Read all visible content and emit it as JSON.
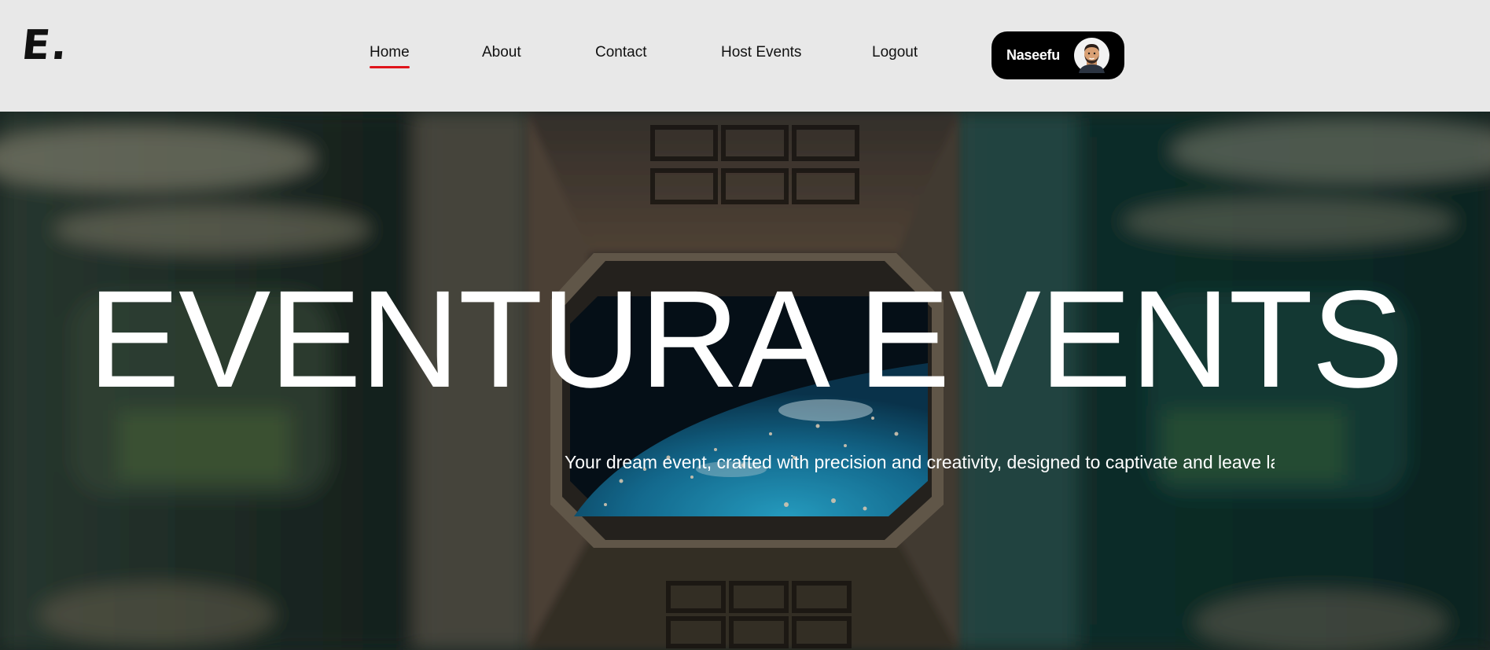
{
  "brand": {
    "logo_text": "E."
  },
  "nav": {
    "items": [
      {
        "label": "Home",
        "active": true
      },
      {
        "label": "About",
        "active": false
      },
      {
        "label": "Contact",
        "active": false
      },
      {
        "label": "Host Events",
        "active": false
      },
      {
        "label": "Logout",
        "active": false
      }
    ]
  },
  "user": {
    "name": "Naseefu",
    "avatar_icon": "user-avatar-icon"
  },
  "hero": {
    "title": "EVENTURA EVENTS",
    "subtitle": "Your dream event, crafted with precision and creativity, designed to captivate and leave lasting memories."
  },
  "colors": {
    "nav_background": "#e8e8e8",
    "active_underline": "#e0151c",
    "user_pill": "#000000",
    "hero_text": "#ffffff"
  }
}
